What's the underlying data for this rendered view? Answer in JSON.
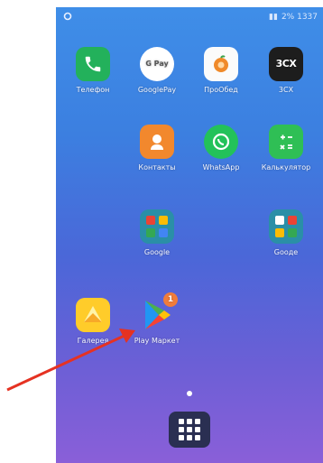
{
  "status_bar": {
    "right_text": "2% 1337"
  },
  "apps": {
    "phone": {
      "label": "Телефон",
      "icon": "phone-icon"
    },
    "googlepay": {
      "label": "GooglePay",
      "icon_text": "G Pay"
    },
    "proobed": {
      "label": "ПроОбед",
      "icon": "orange-icon"
    },
    "threecx": {
      "label": "3CX",
      "icon_text": "3CX"
    },
    "contacts": {
      "label": "Контакты",
      "icon": "contacts-icon"
    },
    "whatsapp": {
      "label": "WhatsApp",
      "icon": "whatsapp-icon"
    },
    "calculator": {
      "label": "Калькулятор",
      "icon": "calculator-icon"
    },
    "google_folder_1": {
      "label": "Google",
      "icon": "folder-icon"
    },
    "google_folder_2": {
      "label": "Gooдe",
      "icon": "folder-icon"
    },
    "gallery": {
      "label": "Галерея",
      "icon": "gallery-icon"
    },
    "playmarket": {
      "label": "Play Маркет",
      "badge": "1",
      "icon": "play-store-icon"
    }
  },
  "colors": {
    "annotation_arrow": "#e53222"
  }
}
